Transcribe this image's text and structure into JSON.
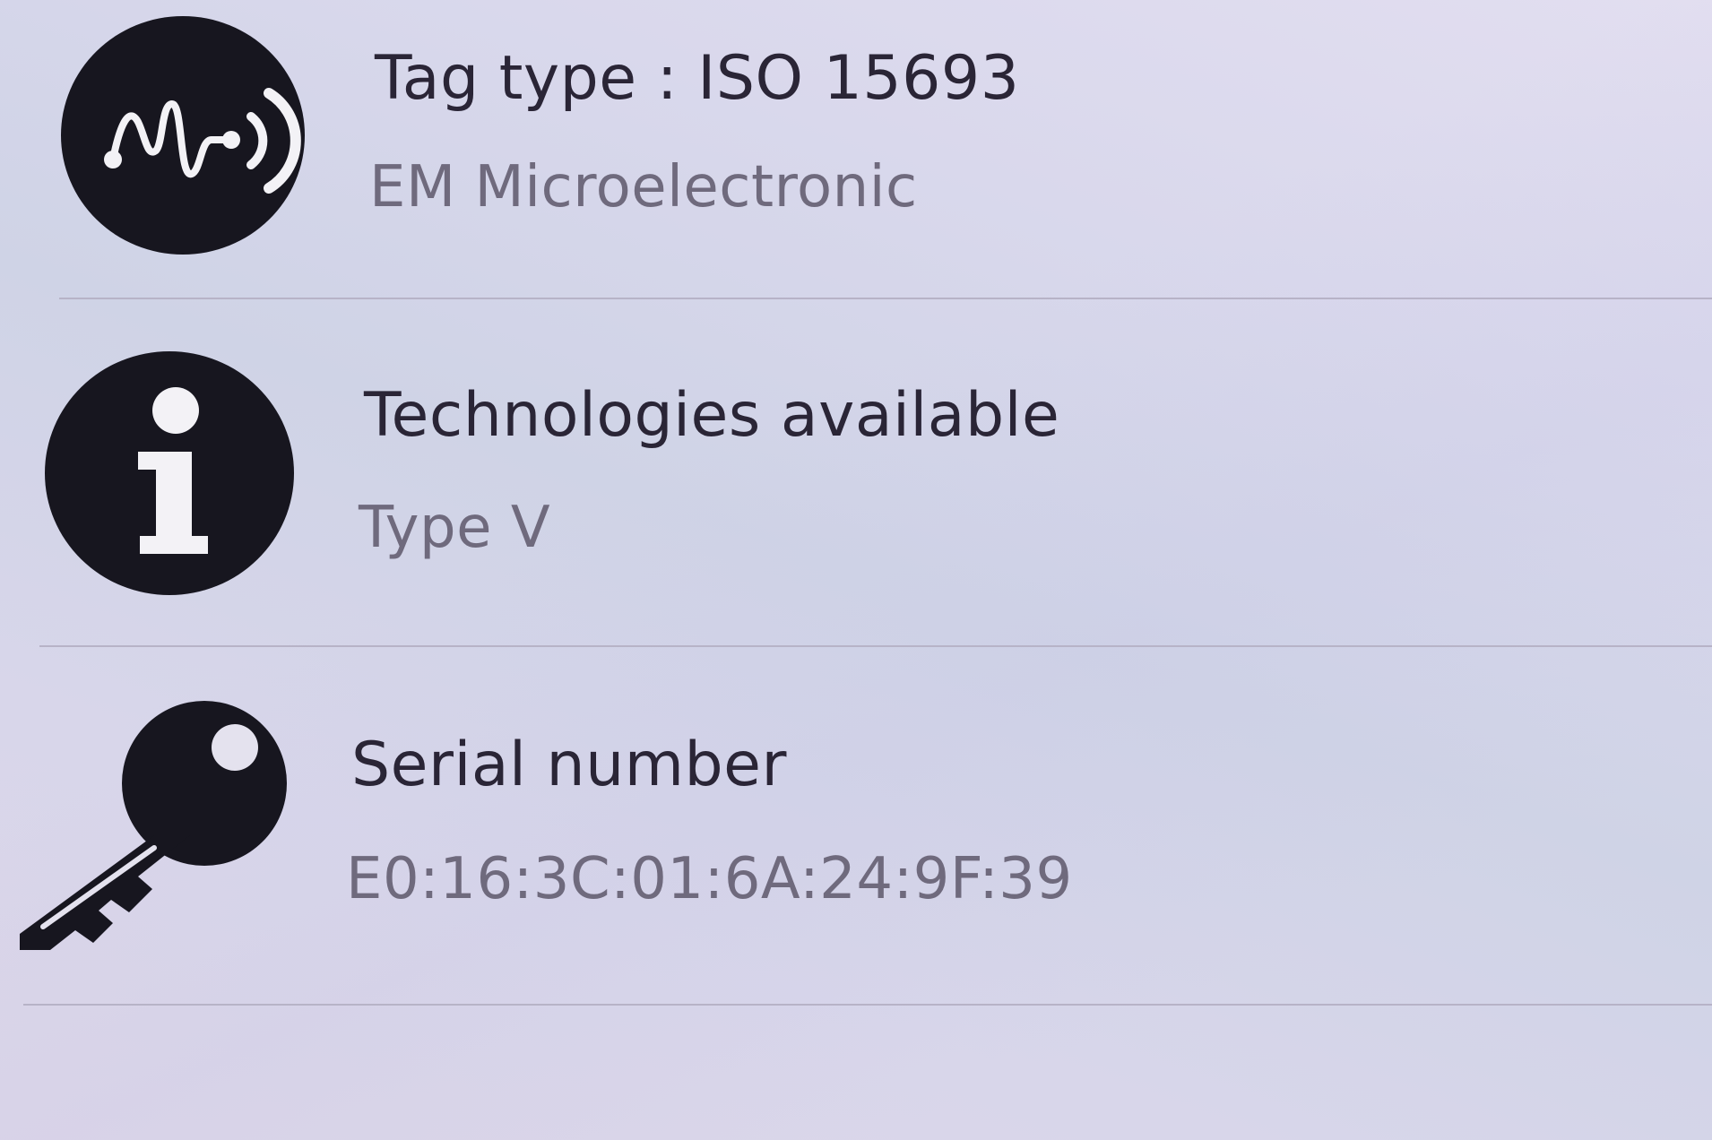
{
  "rows": [
    {
      "icon": "nfc-tag-icon",
      "title": "Tag type : ISO 15693",
      "subtitle": "EM Microelectronic"
    },
    {
      "icon": "info-icon",
      "title": "Technologies available",
      "subtitle": "Type V"
    },
    {
      "icon": "key-icon",
      "title": "Serial number",
      "subtitle": "E0:16:3C:01:6A:24:9F:39"
    }
  ],
  "colors": {
    "icon": "#17161f",
    "title": "#2a2536",
    "subtitle": "#6f6a7d",
    "divider": "#b7b3c7"
  }
}
